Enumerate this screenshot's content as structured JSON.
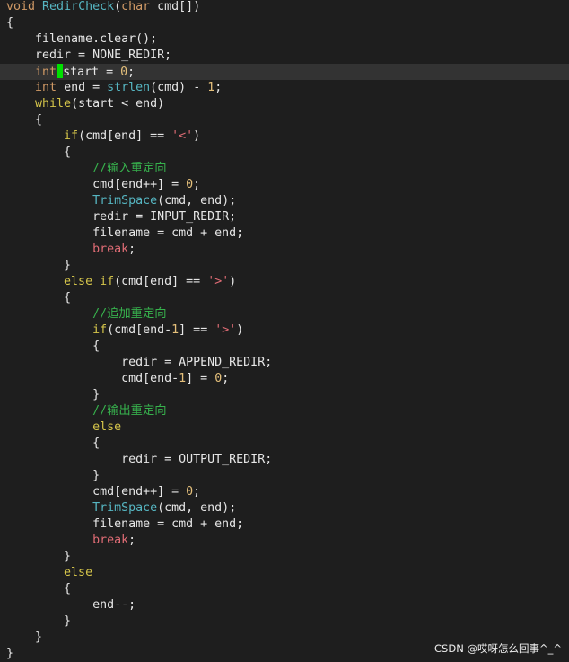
{
  "lines": [
    "void RedirCheck(char cmd[])",
    "{",
    "    filename.clear();",
    "    redir = NONE_REDIR;",
    "    int start = 0;",
    "    int end = strlen(cmd) - 1;",
    "    while(start < end)",
    "    {",
    "        if(cmd[end] == '<')",
    "        {",
    "            //输入重定向",
    "            cmd[end++] = 0;",
    "            TrimSpace(cmd, end);",
    "            redir = INPUT_REDIR;",
    "            filename = cmd + end;",
    "            break;",
    "        }",
    "        else if(cmd[end] == '>')",
    "        {",
    "            //追加重定向",
    "            if(cmd[end-1] == '>')",
    "            {",
    "                redir = APPEND_REDIR;",
    "                cmd[end-1] = 0;",
    "            }",
    "            //输出重定向",
    "            else",
    "            {",
    "                redir = OUTPUT_REDIR;",
    "            }",
    "            cmd[end++] = 0;",
    "            TrimSpace(cmd, end);",
    "            filename = cmd + end;",
    "            break;",
    "        }",
    "        else",
    "        {",
    "            end--;",
    "        }",
    "    }",
    "}"
  ],
  "cursor_line": 4,
  "watermark": "CSDN @哎呀怎么回事^_^",
  "colors": {
    "background": "#1e1e1e",
    "text": "#e6e6e6",
    "keyword": "#e5c07b",
    "function": "#56b6c2",
    "comment": "#37b24d",
    "string": "#e06c75",
    "cursor": "#00e000"
  }
}
